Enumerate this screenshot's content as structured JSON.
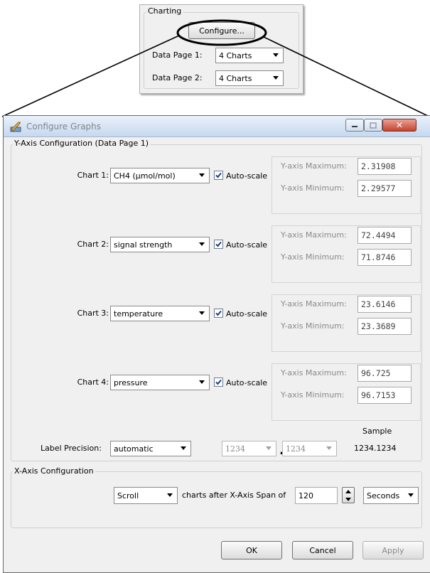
{
  "snippet": {
    "group_title": "Charting",
    "configure_button": "Configure...",
    "page1_label": "Data Page 1:",
    "page1_value": "4 Charts",
    "page2_label": "Data Page 2:",
    "page2_value": "4 Charts"
  },
  "dialog": {
    "title": "Configure Graphs",
    "yaxis_group_title": "Y-Axis Configuration (Data Page 1)",
    "charts": [
      {
        "label": "Chart 1:",
        "channel": "CH4 (µmol/mol)",
        "autoscale_label": "Auto-scale",
        "autoscale_checked": true,
        "max_label": "Y-axis Maximum:",
        "max_value": "2.31908",
        "min_label": "Y-axis Minimum:",
        "min_value": "2.29577"
      },
      {
        "label": "Chart 2:",
        "channel": "signal strength",
        "autoscale_label": "Auto-scale",
        "autoscale_checked": true,
        "max_label": "Y-axis Maximum:",
        "max_value": "72.4494",
        "min_label": "Y-axis Minimum:",
        "min_value": "71.8746"
      },
      {
        "label": "Chart 3:",
        "channel": "temperature",
        "autoscale_label": "Auto-scale",
        "autoscale_checked": true,
        "max_label": "Y-axis Maximum:",
        "max_value": "23.6146",
        "min_label": "Y-axis Minimum:",
        "min_value": "23.3689"
      },
      {
        "label": "Chart 4:",
        "channel": "pressure",
        "autoscale_label": "Auto-scale",
        "autoscale_checked": true,
        "max_label": "Y-axis Maximum:",
        "max_value": "96.725",
        "min_label": "Y-axis Minimum:",
        "min_value": "96.7153"
      }
    ],
    "precision": {
      "label": "Label Precision:",
      "mode": "automatic",
      "int_digits": "1234",
      "dot": ".",
      "frac_digits": "1234",
      "sample_label": "Sample",
      "sample_value": "1234.1234"
    },
    "xaxis": {
      "group_title": "X-Axis Configuration",
      "mode": "Scroll",
      "text": "charts after X-Axis Span of",
      "span_value": "120",
      "unit": "Seconds"
    },
    "buttons": {
      "ok": "OK",
      "cancel": "Cancel",
      "apply": "Apply"
    }
  },
  "colors": {
    "titlebar": "#c7d8ee",
    "close_button": "#c6432e",
    "highlight_ellipse": "#000000"
  },
  "icons": [
    "app-icon",
    "minimize-icon",
    "maximize-icon",
    "close-icon",
    "checkmark-icon",
    "dropdown-arrow-icon",
    "spin-up-icon",
    "spin-down-icon"
  ]
}
